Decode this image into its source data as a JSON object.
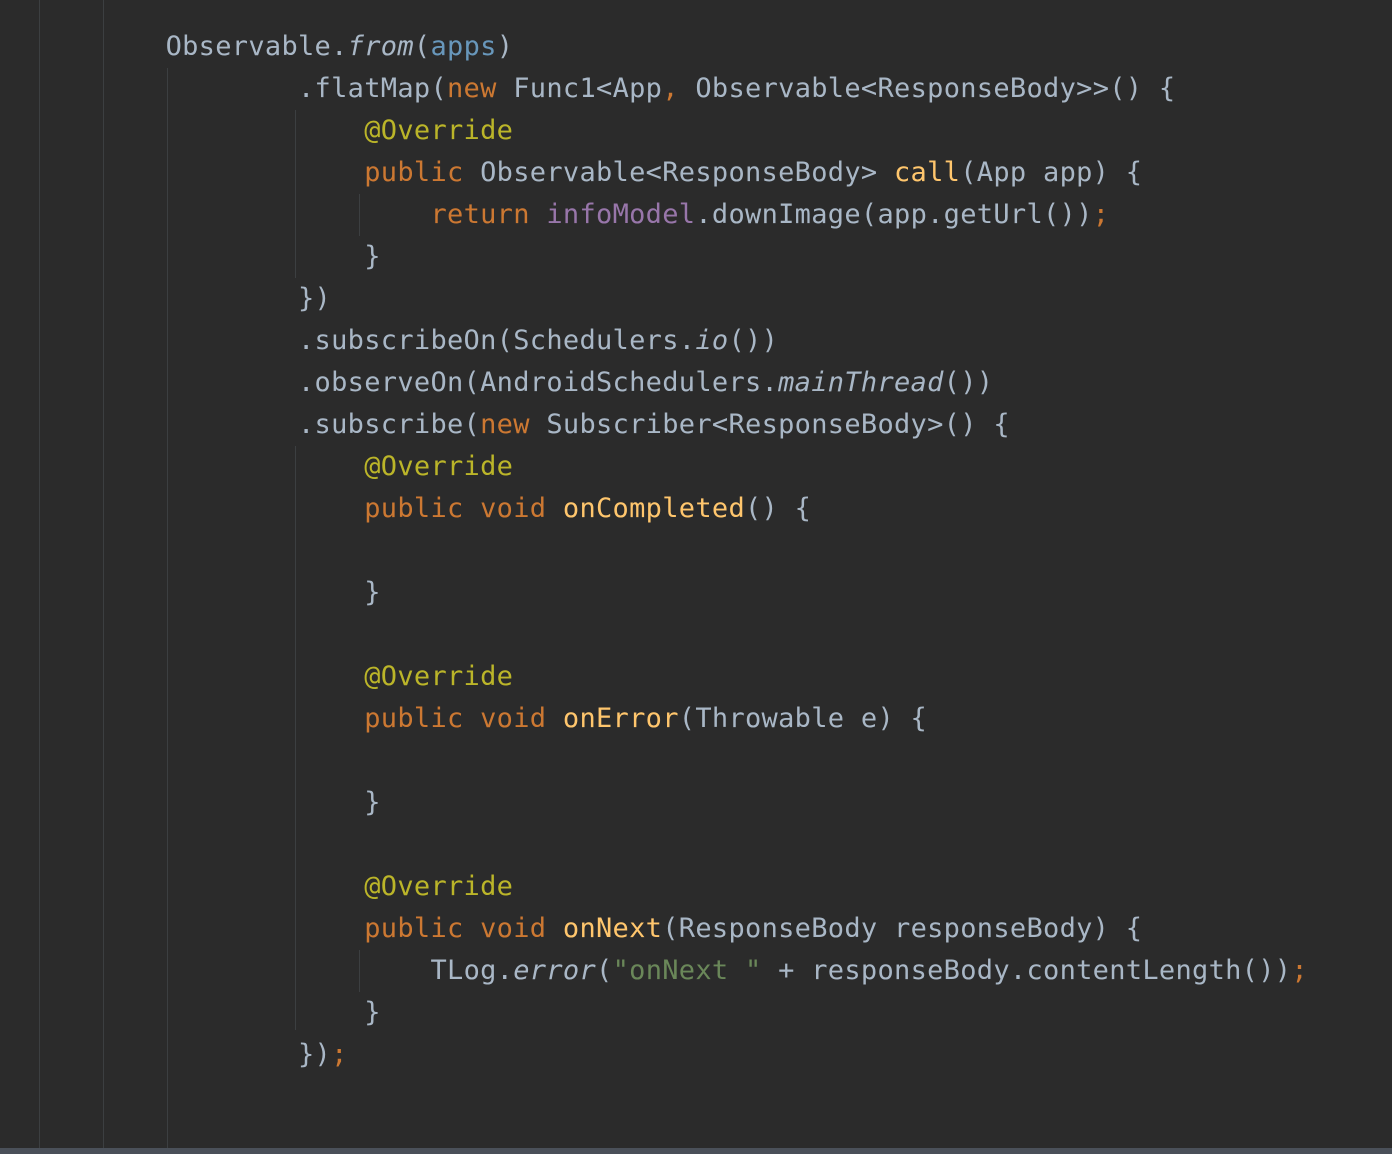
{
  "editor": {
    "language": "Java",
    "theme_colors": {
      "background": "#2b2b2b",
      "default_text": "#a9b7c6",
      "keyword": "#cc7832",
      "annotation": "#bbb529",
      "field": "#9876aa",
      "method_declaration": "#ffc66d",
      "string": "#6a8759",
      "parameter_reference": "#6897bb",
      "indent_guide": "#3c3f41",
      "scrollbar": "#4a5059"
    },
    "lines": [
      [
        {
          "t": "Observable.",
          "c": "p"
        },
        {
          "t": "from",
          "c": "static"
        },
        {
          "t": "(",
          "c": "p"
        },
        {
          "t": "apps",
          "c": "ref"
        },
        {
          "t": ")",
          "c": "p"
        }
      ],
      [
        {
          "t": ".flatMap(",
          "c": "p"
        },
        {
          "t": "new ",
          "c": "kw"
        },
        {
          "t": "Func1<App",
          "c": "p"
        },
        {
          "t": ", ",
          "c": "kw"
        },
        {
          "t": "Observable<ResponseBody>>() {",
          "c": "p"
        }
      ],
      [
        {
          "t": "@Override",
          "c": "ann"
        }
      ],
      [
        {
          "t": "public ",
          "c": "kw"
        },
        {
          "t": "Observable<ResponseBody> ",
          "c": "p"
        },
        {
          "t": "call",
          "c": "meth"
        },
        {
          "t": "(App app) {",
          "c": "p"
        }
      ],
      [
        {
          "t": "return ",
          "c": "kw"
        },
        {
          "t": "infoModel",
          "c": "fld"
        },
        {
          "t": ".downImage(app.getUrl())",
          "c": "p"
        },
        {
          "t": ";",
          "c": "kw"
        }
      ],
      [
        {
          "t": "}",
          "c": "p"
        }
      ],
      [
        {
          "t": "})",
          "c": "p"
        }
      ],
      [
        {
          "t": ".subscribeOn(Schedulers.",
          "c": "p"
        },
        {
          "t": "io",
          "c": "static"
        },
        {
          "t": "())",
          "c": "p"
        }
      ],
      [
        {
          "t": ".observeOn(AndroidSchedulers.",
          "c": "p"
        },
        {
          "t": "mainThread",
          "c": "static"
        },
        {
          "t": "())",
          "c": "p"
        }
      ],
      [
        {
          "t": ".subscribe(",
          "c": "p"
        },
        {
          "t": "new ",
          "c": "kw"
        },
        {
          "t": "Subscriber<ResponseBody>() {",
          "c": "p"
        }
      ],
      [
        {
          "t": "@Override",
          "c": "ann"
        }
      ],
      [
        {
          "t": "public void ",
          "c": "kw"
        },
        {
          "t": "onCompleted",
          "c": "meth"
        },
        {
          "t": "() {",
          "c": "p"
        }
      ],
      [],
      [
        {
          "t": "}",
          "c": "p"
        }
      ],
      [],
      [
        {
          "t": "@Override",
          "c": "ann"
        }
      ],
      [
        {
          "t": "public void ",
          "c": "kw"
        },
        {
          "t": "onError",
          "c": "meth"
        },
        {
          "t": "(Throwable e) {",
          "c": "p"
        }
      ],
      [],
      [
        {
          "t": "}",
          "c": "p"
        }
      ],
      [],
      [
        {
          "t": "@Override",
          "c": "ann"
        }
      ],
      [
        {
          "t": "public void ",
          "c": "kw"
        },
        {
          "t": "onNext",
          "c": "meth"
        },
        {
          "t": "(ResponseBody responseBody) {",
          "c": "p"
        }
      ],
      [
        {
          "t": "TLog.",
          "c": "p"
        },
        {
          "t": "error",
          "c": "static"
        },
        {
          "t": "(",
          "c": "p"
        },
        {
          "t": "\"onNext \"",
          "c": "str"
        },
        {
          "t": " + responseBody.contentLength())",
          "c": "p"
        },
        {
          "t": ";",
          "c": "kw"
        }
      ],
      [
        {
          "t": "}",
          "c": "p"
        }
      ],
      [
        {
          "t": "})",
          "c": "p"
        },
        {
          "t": ";",
          "c": "kw"
        }
      ]
    ]
  }
}
